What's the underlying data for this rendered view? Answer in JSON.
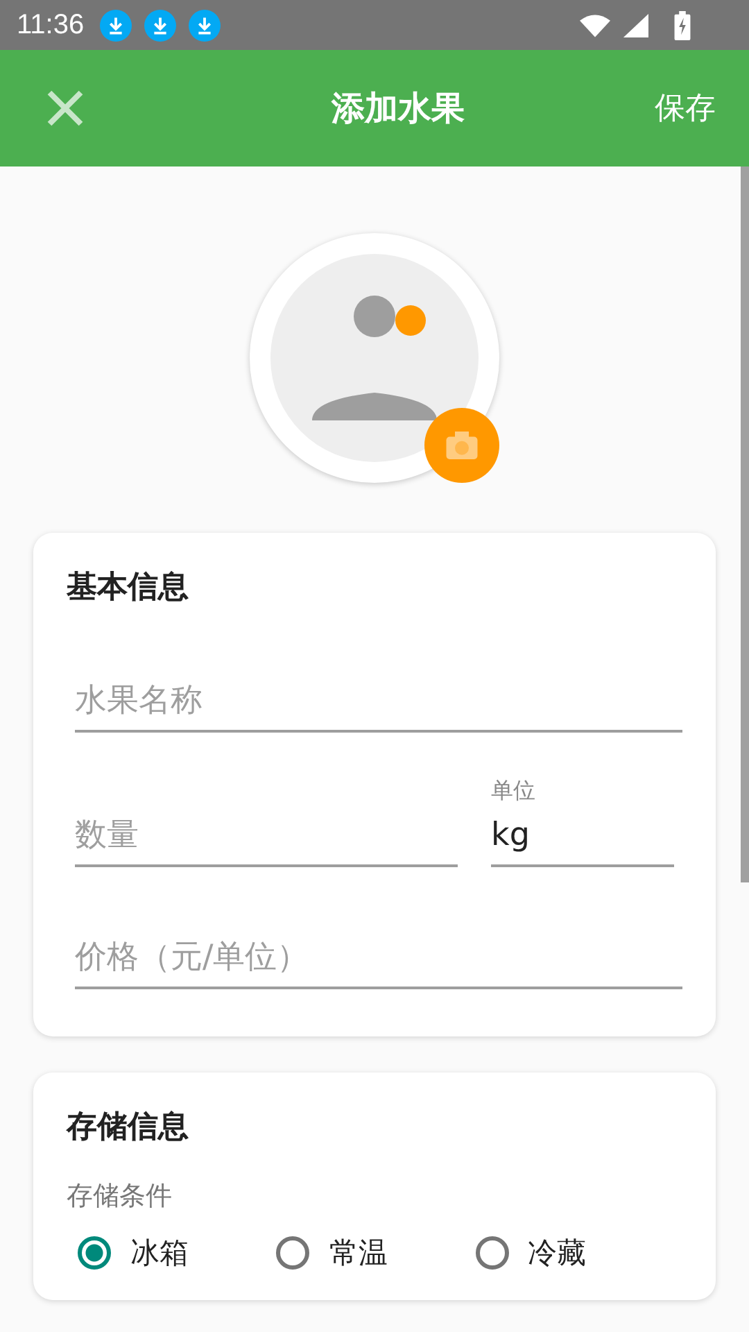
{
  "status_bar": {
    "time": "11:36",
    "notifications": [
      {
        "kind": "download"
      },
      {
        "kind": "download"
      },
      {
        "kind": "download"
      }
    ]
  },
  "app_bar": {
    "title": "添加水果",
    "action": "保存"
  },
  "basic_info": {
    "title": "基本信息",
    "fields": [
      {
        "kind": "full",
        "placeholder": "水果名称"
      },
      {
        "kind": "row",
        "placeholder": "数量",
        "unit_label": "单位",
        "unit_value": "kg"
      },
      {
        "kind": "full",
        "placeholder": "价格（元/单位）"
      }
    ]
  },
  "storage_info": {
    "title": "存储信息",
    "label": "存储条件",
    "options": [
      {
        "label": "冰箱",
        "selected": true
      },
      {
        "label": "常温",
        "selected": false
      },
      {
        "label": "冷藏",
        "selected": false
      }
    ]
  }
}
